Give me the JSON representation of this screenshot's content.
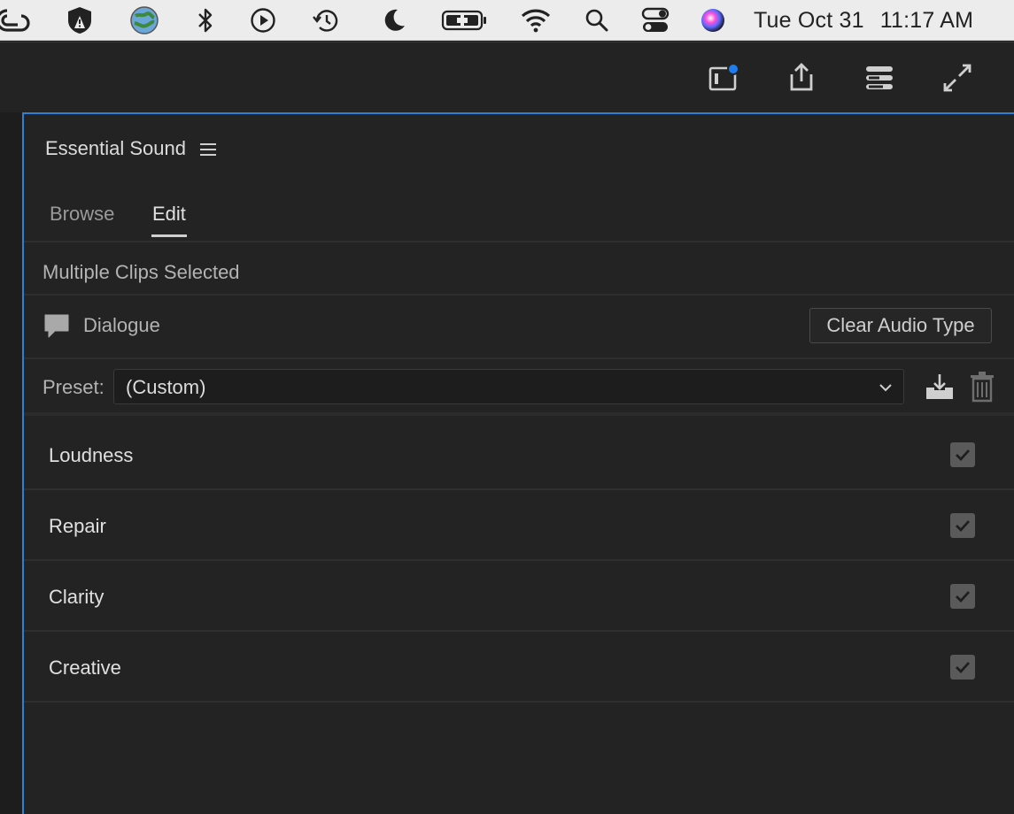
{
  "menubar": {
    "icons": [
      "creative-cloud-icon",
      "adobe-security-icon",
      "globe-sync-icon",
      "bluetooth-icon",
      "play-icon",
      "time-machine-icon",
      "moon-icon",
      "battery-charging-icon",
      "wifi-icon",
      "search-icon",
      "control-center-icon",
      "siri-icon"
    ],
    "date": "Tue Oct 31",
    "time": "11:17 AM"
  },
  "header": {
    "icons": [
      "panel-notification-icon",
      "share-icon",
      "workspaces-icon",
      "fullscreen-icon"
    ],
    "accent": "#1e7ef0"
  },
  "panel": {
    "title": "Essential Sound",
    "menu_icon": "hamburger-icon",
    "border_color": "#2f7fd6",
    "tabs": [
      {
        "label": "Browse",
        "active": false
      },
      {
        "label": "Edit",
        "active": true
      }
    ],
    "selection_status": "Multiple Clips Selected",
    "audio_type": {
      "icon": "speech-bubble-icon",
      "label": "Dialogue",
      "clear_button": "Clear Audio Type"
    },
    "preset": {
      "label": "Preset:",
      "value": "(Custom)",
      "save_icon": "save-preset-icon",
      "delete_icon": "trash-icon"
    },
    "sections": [
      {
        "label": "Loudness",
        "checked": true
      },
      {
        "label": "Repair",
        "checked": true
      },
      {
        "label": "Clarity",
        "checked": true
      },
      {
        "label": "Creative",
        "checked": true
      }
    ]
  }
}
